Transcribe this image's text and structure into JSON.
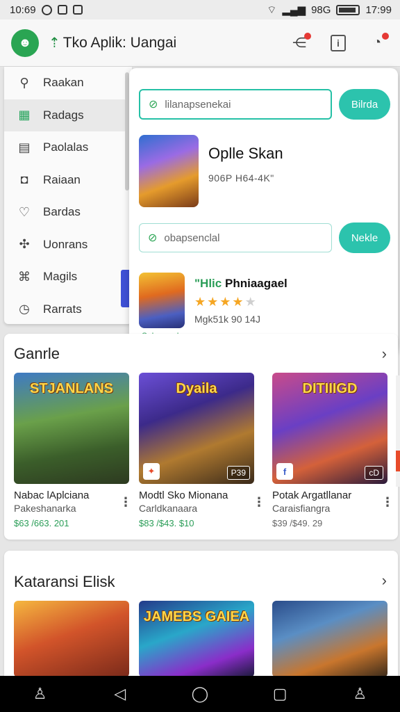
{
  "status_bar": {
    "time_left": "10:69",
    "signal_text": "98G",
    "time_right": "17:99"
  },
  "app_bar": {
    "title": "Tko Aplik: Uangai"
  },
  "side_menu": {
    "items": [
      {
        "label": "Raakan",
        "icon": "robot-icon",
        "glyph": "⚲"
      },
      {
        "label": "Radags",
        "icon": "grid-icon",
        "glyph": "▦"
      },
      {
        "label": "Paolalas",
        "icon": "document-icon",
        "glyph": "▤"
      },
      {
        "label": "Raiaan",
        "icon": "bag-icon",
        "glyph": "◘"
      },
      {
        "label": "Bardas",
        "icon": "heart-icon",
        "glyph": "♡"
      },
      {
        "label": "Uonrans",
        "icon": "puzzle-icon",
        "glyph": "✣"
      },
      {
        "label": "Magils",
        "icon": "map-icon",
        "glyph": "⌘"
      },
      {
        "label": "Rarrats",
        "icon": "chat-icon",
        "glyph": "◷"
      }
    ]
  },
  "popup": {
    "search1": {
      "placeholder": "lilanapsenekai",
      "button": "Bilrda"
    },
    "result1": {
      "title": "Oplle Skan",
      "sub": "906P H64-4K\""
    },
    "search2": {
      "placeholder": "obapsenclal",
      "button": "Nekle"
    },
    "result2": {
      "prefix": "\"Hlic",
      "title": "Phniaagael",
      "rating": 4,
      "sub": "Mgk51k 90 14J",
      "tag": "Selpaneaka"
    }
  },
  "section1": {
    "title": "Ganrle",
    "cards": [
      {
        "banner": "STJANLANS",
        "name": "Nabac lAplciana",
        "dev": "Pakeshanarka",
        "price": "$63 /663. 201",
        "badge_left": "",
        "badge_right": ""
      },
      {
        "banner": "Dyaila",
        "name": "Modtl Sko Mionana",
        "dev": "Carldkanaara",
        "price": "$83 /$43. $10",
        "badge_left": "✦",
        "badge_right": "P39"
      },
      {
        "banner": "DITIIIGD",
        "name": "Potak Argatllanar",
        "dev": "Caraisfiangra",
        "price": "$39 /$49. 29",
        "badge_left": "f",
        "badge_right": "cD"
      }
    ]
  },
  "section2": {
    "title": "Kataransi Elisk",
    "cards": [
      {
        "banner": ""
      },
      {
        "banner": "JAMEBS GAIEA"
      },
      {
        "banner": ""
      }
    ]
  },
  "colors": {
    "accent": "#2cc3ad",
    "green": "#2aa553",
    "notification": "#e53935"
  }
}
